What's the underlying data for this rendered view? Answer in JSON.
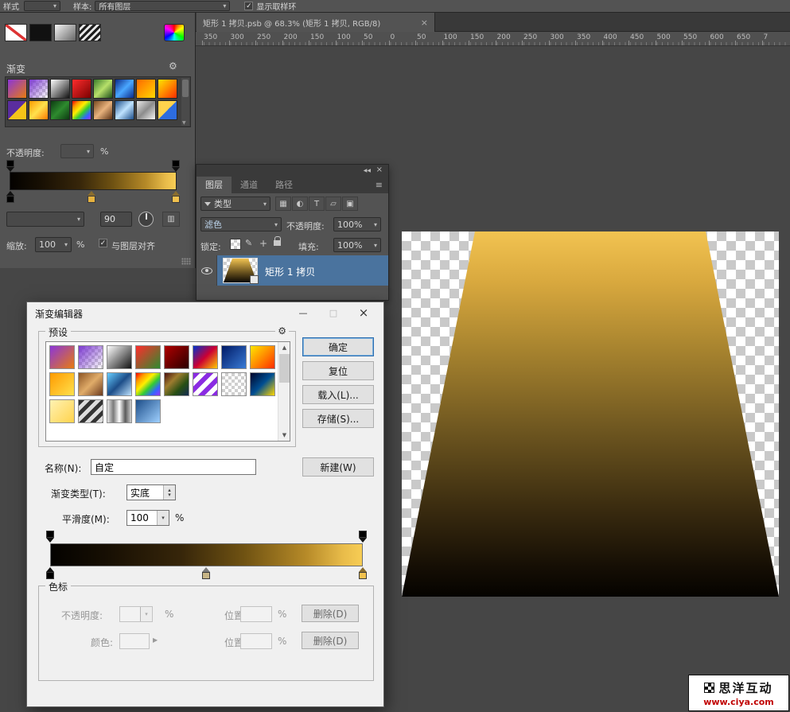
{
  "icons": {
    "gear": "⚙",
    "close": "×",
    "minimize": "—",
    "maximize": "□",
    "arrow_down": "▾",
    "tri_up": "▴",
    "arrow_right": "▶",
    "scroll_up": "▲",
    "scroll_down": "▼",
    "check": "✓",
    "collapse_panel": "◀◀",
    "panel_menu": "≡",
    "filter_image": "▦",
    "filter_adjustment": "◐",
    "filter_type": "T",
    "filter_shape": "▱",
    "filter_smart": "▣",
    "lock_transparency": "▨",
    "lock_brush": "✎",
    "lock_position": "+",
    "stack": "▥"
  },
  "options_bar": {
    "style_label": "样式",
    "sample_label": "样本:",
    "sample_value": "所有图层",
    "show_ring_label": "显示取样环"
  },
  "gradient_panel": {
    "title": "渐变",
    "opacity_label": "不透明度:",
    "percent": "%",
    "angle_value": "90",
    "scale_label": "缩放:",
    "scale_value": "100",
    "align_label": "与图层对齐",
    "presets": [
      "linear-gradient(135deg,#8b36d9,#e87b10)",
      "linear-gradient(135deg,#7d3bd1,rgba(125,59,209,0)), conic-gradient(#cfcfcf 25%,#fff 0 50%,#cfcfcf 0 75%,#fff 0) 0 0/8px 8px",
      "linear-gradient(135deg,#ffffff,#111111)",
      "linear-gradient(135deg,#ff2d2d,#7a0000)",
      "linear-gradient(135deg,#3a7d2c,#b7e06a,#1c4f1a)",
      "linear-gradient(135deg,#0b2a8a,#4aa7ff,#0b2a8a)",
      "linear-gradient(135deg,#ff6a00,#ffd800)",
      "linear-gradient(135deg,#ffe600,#ff2d00)",
      "linear-gradient(135deg,#5a2d9e 0 50%,#f5c518 50% 100%)",
      "linear-gradient(135deg,#ff9a00,#ffe14d,#ff7a00)",
      "linear-gradient(135deg,#0d3b12,#2e8b2e,#0d3b12)",
      "linear-gradient(135deg,#ff0000,#ff9900,#ffee00,#33cc33,#3366ff,#9933ff)",
      "linear-gradient(135deg,#7a4a21,#e8b27d,#5c3317)",
      "linear-gradient(135deg,#1d4e89,#bfe3ff,#1d4e89)",
      "linear-gradient(135deg,#e8e8e8,#8c8c8c,#f5f5f5)",
      "linear-gradient(135deg,#ffd34d 0 50%,#2d6cdf 50% 100%)"
    ]
  },
  "document": {
    "tab_title": "矩形 1 拷贝.psb @ 68.3% (矩形 1 拷贝, RGB/8)",
    "ruler_labels": [
      "350",
      "300",
      "250",
      "200",
      "150",
      "100",
      "50",
      "0",
      "50",
      "100",
      "150",
      "200",
      "250",
      "300",
      "350",
      "400",
      "450",
      "500",
      "550",
      "600",
      "650",
      "7"
    ]
  },
  "layers_panel": {
    "tab_layers": "图层",
    "tab_channels": "通道",
    "tab_paths": "路径",
    "filter_label": "类型",
    "blend_mode": "滤色",
    "opacity_label": "不透明度:",
    "opacity_value": "100%",
    "lock_label": "锁定:",
    "fill_label": "填充:",
    "fill_value": "100%",
    "layer_name": "矩形 1 拷贝"
  },
  "gradient_editor": {
    "title": "渐变编辑器",
    "presets_label": "预设",
    "ok": "确定",
    "reset": "复位",
    "load": "载入(L)...",
    "save": "存储(S)...",
    "new": "新建(W)",
    "name_label": "名称(N):",
    "name_value": "自定",
    "type_label": "渐变类型(T):",
    "type_value": "实底",
    "smooth_label": "平滑度(M):",
    "smooth_value": "100",
    "percent": "%",
    "stops_group_label": "色标",
    "stop_opacity_label": "不透明度:",
    "position_label": "位置:",
    "delete_label": "删除(D)",
    "color_label": "颜色:",
    "presets": [
      "linear-gradient(135deg,#8b36d9,#e87b10)",
      "linear-gradient(135deg,#7d3bd1,rgba(125,59,209,0)), conic-gradient(#cfcfcf 25%,#fff 0 50%,#cfcfcf 0 75%,#fff 0) 0 0/8px 8px",
      "linear-gradient(135deg,#ffffff,#111111)",
      "linear-gradient(135deg,#ff2d2d,#2e8b2e)",
      "linear-gradient(135deg,#b00000,#2a0000)",
      "linear-gradient(135deg,#0033cc,#cc0033,#ffcc00)",
      "linear-gradient(135deg,#001a66,#3a7bd5)",
      "linear-gradient(135deg,#ffe600,#ff8c00,#ff2d00)",
      "linear-gradient(135deg,#ff9a00,#ffe14d)",
      "linear-gradient(135deg,#8d5524,#e0ac69,#6b3a1f)",
      "linear-gradient(135deg,#66ccff,#1d4e89,#bfe3ff)",
      "linear-gradient(135deg,#ff0000,#ff9900,#ffee00,#33cc33,#3366ff,#9933ff)",
      "linear-gradient(135deg,#4b0f0f,#9e7c2f,#274e13,#132a52)",
      "repeating-linear-gradient(135deg,#8a2be2 0 6px,#ffffff 6px 12px)",
      "conic-gradient(#cfcfcf 25%,#fff 0 50%,#cfcfcf 0 75%,#fff 0) 0 0/8px 8px",
      "linear-gradient(135deg,#000428,#004e92,#ffd700)",
      "linear-gradient(135deg,#fff2b3,#ffd34d)",
      "repeating-linear-gradient(135deg,#333 0 5px,#ddd 5px 10px)",
      "linear-gradient(90deg,#e8e8e8,#7a7a7a,#ffffff,#5a5a5a,#d0d0d0)",
      "linear-gradient(135deg,#1d4e89,#9fd0ff)"
    ]
  },
  "gradients": {
    "bar": "linear-gradient(90deg,#040200 0%,#170f03 18%,#37260a 42%,#6f5212 62%,#b68a28 82%,#e9bc4a 94%,#f7cd55 100%)",
    "shape": "linear-gradient(180deg,#f2c351 0%,#d8a83e 14%,#a8842f 32%,#6f5720 54%,#3c2d10 75%,#150e04 92%,#050300 100%)",
    "thumbnail": "linear-gradient(180deg,#f2c351,#6f5720 55%,#0a0602)"
  },
  "stop_colors": {
    "black": "#000000",
    "mid": "#c8b687",
    "gold": "#f2c14e"
  },
  "watermark": {
    "title": "思洋互动",
    "url": "www.ciya.com"
  }
}
